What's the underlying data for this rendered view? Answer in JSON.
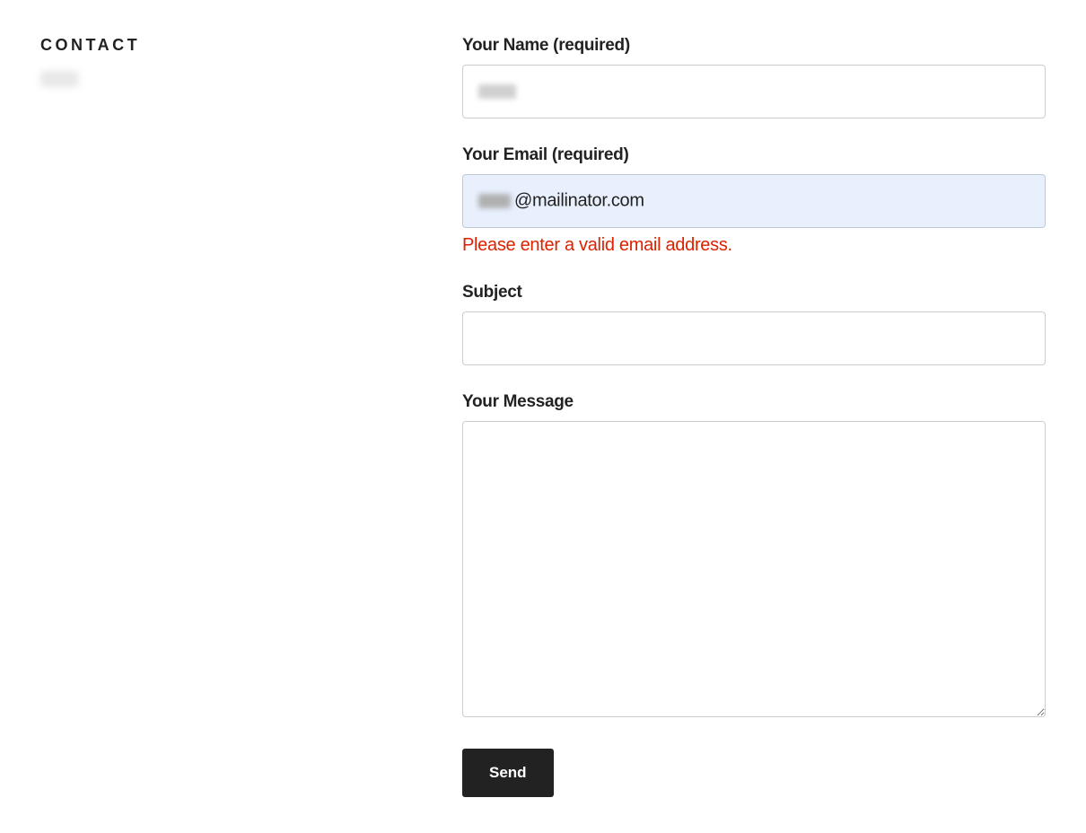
{
  "sidebar": {
    "heading": "CONTACT"
  },
  "form": {
    "name": {
      "label": "Your Name (required)",
      "value": ""
    },
    "email": {
      "label": "Your Email (required)",
      "visible_suffix": "@mailinator.com",
      "value": "",
      "error": "Please enter a valid email address."
    },
    "subject": {
      "label": "Subject",
      "value": ""
    },
    "message": {
      "label": "Your Message",
      "value": ""
    },
    "submit_label": "Send"
  }
}
